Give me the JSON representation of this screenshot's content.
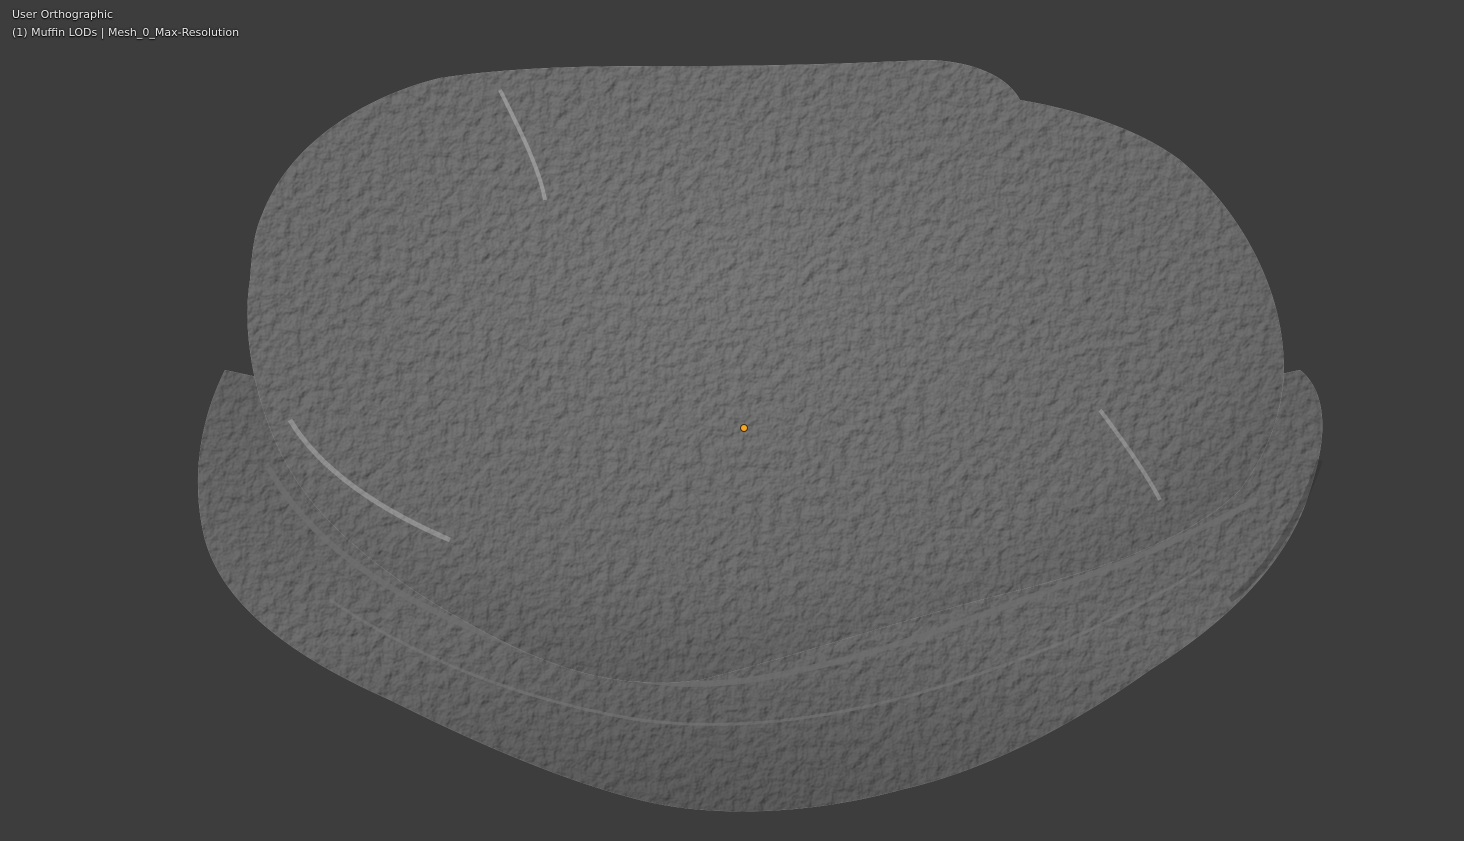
{
  "viewport": {
    "view_mode": "User Orthographic",
    "object_info": "(1) Muffin LODs | Mesh_0_Max-Resolution",
    "background_color": "#3d3d3d",
    "mesh_color": "#a9a9a9",
    "origin_color": "#f5a623"
  },
  "icons": {
    "origin": "object-origin-icon",
    "mesh": "mesh-object-icon"
  }
}
